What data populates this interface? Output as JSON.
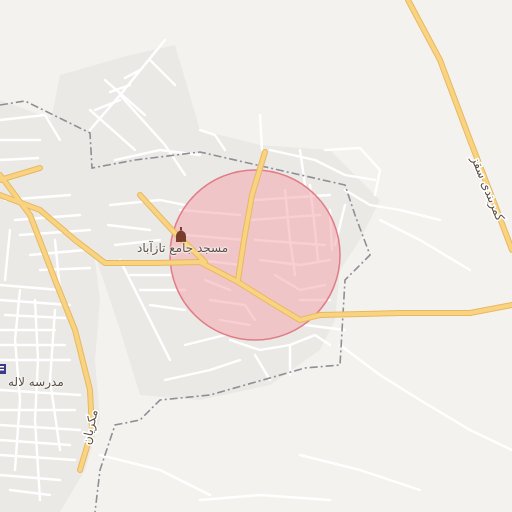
{
  "map": {
    "colors": {
      "background": "#f4f2ee",
      "urban": "#ebe9e5",
      "minor_road": "#ffffff",
      "major_road_fill": "#f9d37f",
      "major_road_casing": "#e6b862",
      "boundary": "#8e8e96",
      "highlight_fill": "#f4a8ae",
      "highlight_stroke": "#e07d86",
      "poi": "#7a3c2a"
    },
    "labels": {
      "mosque": "مسجد جامع تازآباد",
      "school": "مدرسه لاله",
      "bypass": "کمربندی سقز",
      "mokrian": "مکریان"
    },
    "icons": {
      "mosque": "mosque-icon",
      "school": "school-icon"
    }
  }
}
